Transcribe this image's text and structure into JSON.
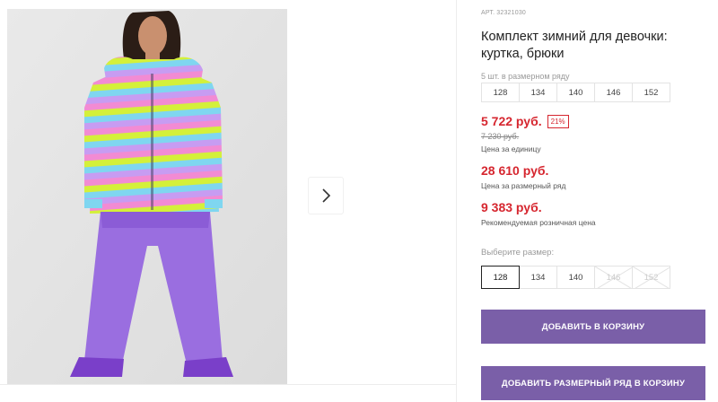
{
  "gallery": {
    "next_icon": "chevron-right-icon"
  },
  "product": {
    "article_prefix": "АРТ.",
    "article_number": "32321030",
    "title": "Комплект зимний для девочки: куртка, брюки",
    "pack_note": "5 шт. в размерном ряду",
    "pack_sizes": [
      "128",
      "134",
      "140",
      "146",
      "152"
    ]
  },
  "prices": {
    "unit_price": "5 722 руб.",
    "discount": "21%",
    "old_price": "7 230 руб.",
    "unit_label": "Цена за единицу",
    "pack_price": "28 610 руб.",
    "pack_label": "Цена за размерный ряд",
    "rrp_price": "9 383 руб.",
    "rrp_label": "Рекомендуемая розничная цена"
  },
  "size_select": {
    "label": "Выберите размер:",
    "options": [
      {
        "value": "128",
        "state": "selected"
      },
      {
        "value": "134",
        "state": "available"
      },
      {
        "value": "140",
        "state": "available"
      },
      {
        "value": "146",
        "state": "unavailable"
      },
      {
        "value": "152",
        "state": "unavailable"
      }
    ]
  },
  "actions": {
    "add_to_cart": "ДОБАВИТЬ В КОРЗИНУ",
    "add_pack_to_cart": "ДОБАВИТЬ РАЗМЕРНЫЙ РЯД В КОРЗИНУ"
  },
  "colors": {
    "accent_button": "#7a5fa8",
    "price_red": "#d6262f"
  }
}
